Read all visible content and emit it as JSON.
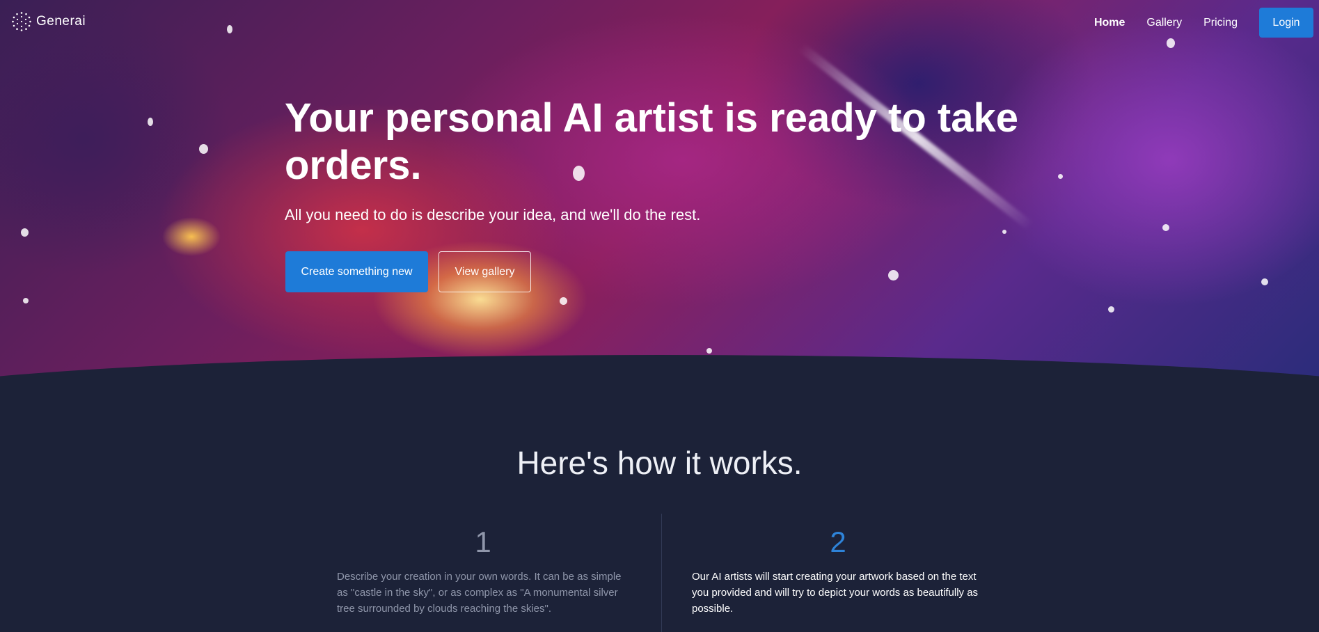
{
  "brand": {
    "name": "Generai",
    "logo_icon": "dotted-sphere-icon"
  },
  "nav": {
    "links": [
      "Home",
      "Gallery",
      "Pricing"
    ],
    "active": "Home",
    "login_label": "Login"
  },
  "hero": {
    "headline": "Your personal AI artist is ready to take orders.",
    "subheadline": "All you need to do is describe your idea, and we'll do the rest.",
    "primary_cta": "Create something new",
    "secondary_cta": "View gallery"
  },
  "how_it_works": {
    "title": "Here's how it works.",
    "steps": [
      {
        "number": "1",
        "text": "Describe your creation in your own words. It can be as simple as \"castle in the sky\", or as complex as \"A monumental silver tree surrounded by clouds reaching the skies\"."
      },
      {
        "number": "2",
        "text": "Our AI artists will start creating your artwork based on the text you provided and will try to depict your words as beautifully as possible."
      }
    ]
  },
  "colors": {
    "accent": "#1e7bd8",
    "background": "#1c2238",
    "step_highlight": "#2e83d8"
  }
}
